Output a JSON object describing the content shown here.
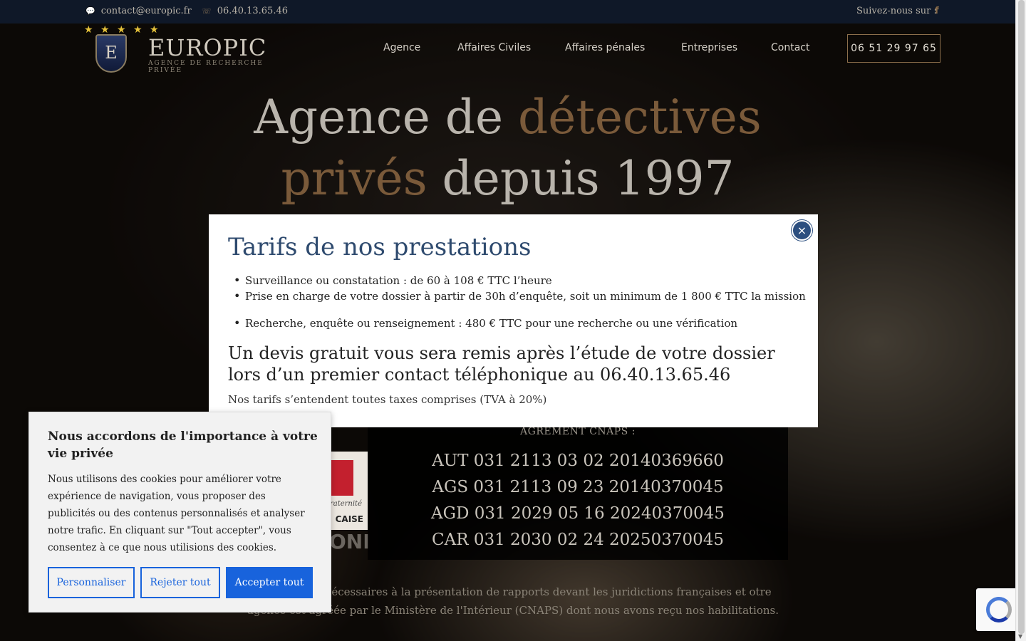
{
  "topbar": {
    "email": "contact@europic.fr",
    "phone": "06.40.13.65.46",
    "follow_label": "Suivez-nous sur :",
    "email_icon": "chat-icon",
    "phone_icon": "phone-icon",
    "facebook_icon": "facebook-icon",
    "facebook_glyph": "f"
  },
  "logo": {
    "name": "EUROPIC",
    "tagline": "AGENCE DE RECHERCHE PRIVÉE",
    "emblem_letter": "E",
    "stars": "★ ★ ★ ★ ★"
  },
  "nav": {
    "items": [
      "Agence",
      "Affaires Civiles",
      "Affaires pénales",
      "Entreprises",
      "Contact"
    ],
    "phone_button": "06 51 29 97 65"
  },
  "hero": {
    "title_part1": "Agence de ",
    "title_accent1": "détectives",
    "title_accent2": "privés",
    "title_part2": " depuis 1997",
    "agreement_label": "AGRÉMENT CNAPS :",
    "agreements": [
      "AUT 031 2113 03 02 20140369660",
      "AGS 031 2113 09 23 20140370045",
      "AGD 031 2029 05 16 20240370045",
      "CAR 031 2030 02 24 20250370045"
    ],
    "flag_motto": "Fraternité",
    "flag_country": "CAISE",
    "flag_under": "ONI",
    "paragraph": "s agréments nécessaires à la présentation de rapports devant les juridictions françaises et otre agence est agréée par le Ministère de l'Intérieur (CNAPS) dont nous avons reçu nos habilitations."
  },
  "modal": {
    "title": "Tarifs de nos prestations",
    "items": [
      "Surveillance ou constatation : de 60 à 108 € TTC l’heure",
      "Prise en charge de votre dossier à partir de 30h d’enquête, soit un minimum de 1 800 € TTC la mission",
      "Recherche, enquête ou renseignement : 480 € TTC pour une recherche ou une vérification"
    ],
    "subtitle": "Un devis gratuit vous sera remis après l’étude de votre dossier lors d’un premier contact téléphonique au 06.40.13.65.46",
    "note": "Nos tarifs s’entendent toutes taxes comprises (TVA à 20%)",
    "close_glyph": "×"
  },
  "cookie": {
    "title": "Nous accordons de l'importance à votre vie privée",
    "text": "Nous utilisons des cookies pour améliorer votre expérience de navigation, vous proposer des publicités ou des contenus personnalisés et analyser notre trafic. En cliquant sur \"Tout accepter\", vous consentez à ce que nous utilisions des cookies.",
    "btn_customize": "Personnaliser",
    "btn_reject": "Rejeter tout",
    "btn_accept": "Accepter tout"
  },
  "colors": {
    "accent": "#7a5a3a",
    "modal_title": "#2e4a6e",
    "cookie_primary": "#1863dc",
    "topbar_bg": "#0f1828"
  }
}
